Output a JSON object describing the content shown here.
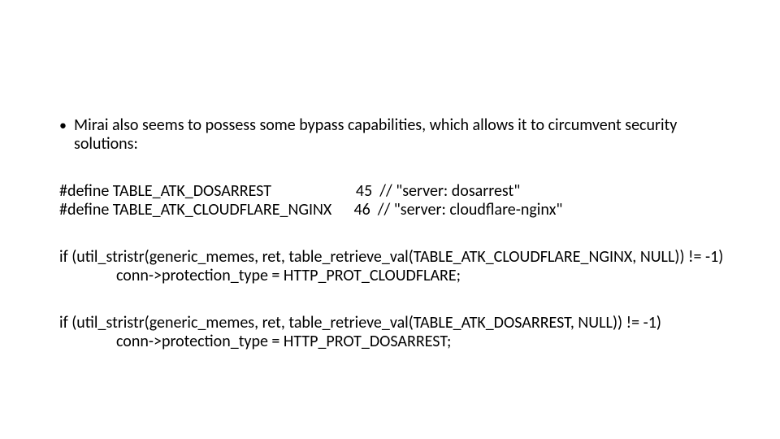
{
  "bullet": {
    "marker": "•",
    "text": "Mirai also seems to possess some bypass capabilities, which allows it to circumvent security solutions:"
  },
  "defines": {
    "line1": "#define TABLE_ATK_DOSARREST                       45  // \"server: dosarrest\"",
    "line2": "#define TABLE_ATK_CLOUDFLARE_NGINX      46  // \"server: cloudflare-nginx\""
  },
  "if1": {
    "cond": "if (util_stristr(generic_memes, ret, table_retrieve_val(TABLE_ATK_CLOUDFLARE_NGINX, NULL)) != -1)",
    "body": "conn->protection_type = HTTP_PROT_CLOUDFLARE;"
  },
  "if2": {
    "cond": "if (util_stristr(generic_memes, ret, table_retrieve_val(TABLE_ATK_DOSARREST, NULL)) != -1)",
    "body": "conn->protection_type = HTTP_PROT_DOSARREST;"
  }
}
